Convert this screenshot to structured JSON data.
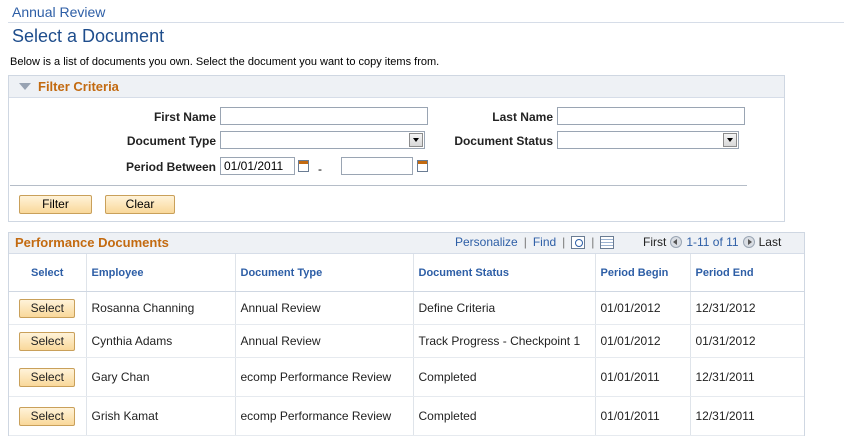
{
  "breadcrumb": {
    "label": "Annual Review"
  },
  "page": {
    "title": "Select a Document",
    "instructions": "Below is a list of documents you own. Select the document you want to copy items from."
  },
  "filter": {
    "title": "Filter Criteria",
    "first_name_label": "First Name",
    "first_name_value": "",
    "last_name_label": "Last Name",
    "last_name_value": "",
    "doc_type_label": "Document Type",
    "doc_type_value": "",
    "doc_status_label": "Document Status",
    "doc_status_value": "",
    "period_label": "Period Between",
    "period_from": "01/01/2011",
    "period_to": "",
    "period_dash": "-",
    "filter_button": "Filter",
    "clear_button": "Clear"
  },
  "grid": {
    "title": "Performance Documents",
    "personalize": "Personalize",
    "separator": "|",
    "find": "Find",
    "first": "First",
    "range": "1-11 of 11",
    "last": "Last",
    "columns": [
      "Select",
      "Employee",
      "Document Type",
      "Document Status",
      "Period Begin",
      "Period End"
    ],
    "rows": [
      {
        "select": "Select",
        "employee": "Rosanna Channing",
        "doc_type": "Annual Review",
        "status": "Define Criteria",
        "begin": "01/01/2012",
        "end": "12/31/2012"
      },
      {
        "select": "Select",
        "employee": "Cynthia Adams",
        "doc_type": "Annual Review",
        "status": "Track Progress - Checkpoint 1",
        "begin": "01/01/2012",
        "end": "01/31/2012"
      },
      {
        "select": "Select",
        "employee": "Gary Chan",
        "doc_type": "ecomp Performance Review",
        "status": "Completed",
        "begin": "01/01/2011",
        "end": "12/31/2011"
      },
      {
        "select": "Select",
        "employee": "Grish Kamat",
        "doc_type": "ecomp Performance Review",
        "status": "Completed",
        "begin": "01/01/2011",
        "end": "12/31/2011"
      }
    ]
  },
  "colors": {
    "link": "#2d5ea6",
    "section_title": "#c36a10",
    "button_bg": "#f9d89a"
  }
}
